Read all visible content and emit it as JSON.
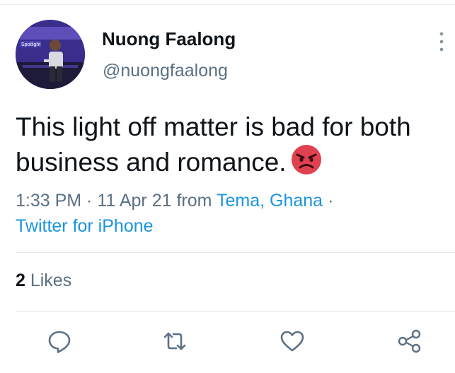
{
  "author": {
    "display_name": "Nuong Faalong",
    "handle": "@nuongfaalong",
    "avatar_caption": "Spotlight"
  },
  "tweet": {
    "text": "This light off matter is bad for both business and romance.",
    "emoji": "angry-face-icon"
  },
  "meta": {
    "time": "1:33 PM",
    "sep1": " · ",
    "date": "11 Apr 21",
    "from_word": " from ",
    "location": "Tema, Ghana",
    "sep2": " ·",
    "client": "Twitter for iPhone"
  },
  "stats": {
    "likes_count": "2",
    "likes_label": " Likes"
  },
  "actions": [
    {
      "icon": "reply-icon"
    },
    {
      "icon": "retweet-icon"
    },
    {
      "icon": "like-heart-icon"
    },
    {
      "icon": "share-icon"
    }
  ],
  "colors": {
    "text": "#0f1419",
    "secondary": "#5b7083",
    "link": "#1b95e0",
    "divider": "#dfe6ea",
    "emoji": "#e0414f"
  }
}
